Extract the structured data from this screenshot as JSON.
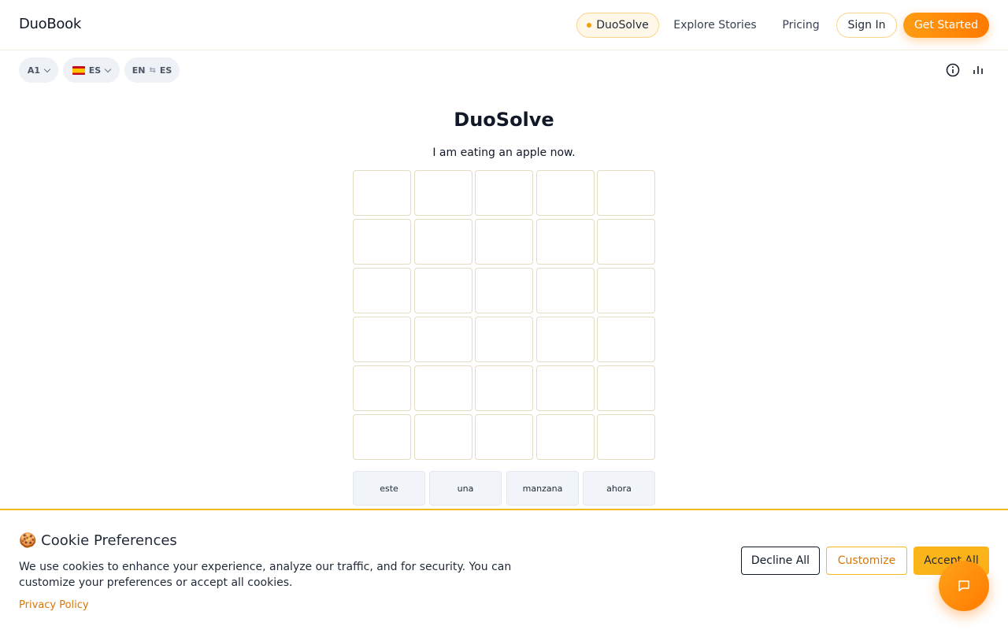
{
  "header": {
    "logo": "DuoBook",
    "nav": {
      "duosolve": "DuoSolve",
      "explore": "Explore Stories",
      "pricing": "Pricing",
      "signin": "Sign In",
      "get_started": "Get Started"
    },
    "colors": {
      "accent": "#ff8c00",
      "highlight_bg": "#fff7e8"
    }
  },
  "toolbar": {
    "level": "A1",
    "language": "ES",
    "direction_from": "EN",
    "direction_to": "ES",
    "icons": [
      "info-icon",
      "bar-chart-icon",
      "chevron-down-icon",
      "swap-icon",
      "spain-flag-icon"
    ]
  },
  "game": {
    "title": "DuoSolve",
    "prompt": "I am eating an apple now.",
    "rows": 6,
    "columns": 5,
    "word_bank": [
      "este",
      "una",
      "manzana",
      "ahora"
    ]
  },
  "cookie": {
    "title": "🍪 Cookie Preferences",
    "text": "We use cookies to enhance your experience, analyze our traffic, and for security. You can customize your preferences or accept all cookies.",
    "privacy_link": "Privacy Policy",
    "decline": "Decline All",
    "customize": "Customize",
    "accept": "Accept All"
  },
  "chat": {
    "icon": "chat-bubble-icon"
  }
}
